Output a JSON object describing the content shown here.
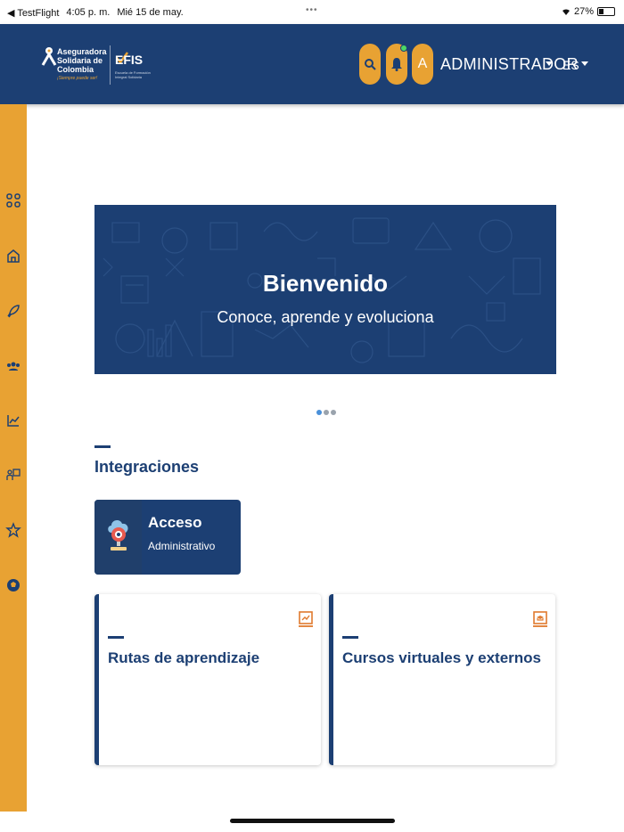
{
  "status_bar": {
    "back_app": "◀ TestFlight",
    "time": "4:05 p. m.",
    "date": "Mié 15 de may.",
    "dots": "•••",
    "battery": "27%"
  },
  "header": {
    "logo": {
      "name": "Aseguradora Solidaria de Colombia",
      "slogan": "¡Siempre puede ser!",
      "product": "EFIS",
      "product_sub": "Escuela de Formación Integral Solidaria"
    },
    "user_initial": "A",
    "user_name": "ADMINISTRADOR",
    "language": "ES"
  },
  "sidebar": {
    "items": [
      "apps-icon",
      "home-icon",
      "rocket-icon",
      "groups-icon",
      "chart-icon",
      "teacher-icon",
      "star-icon",
      "soccer-icon"
    ]
  },
  "banner": {
    "title": "Bienvenido",
    "subtitle": "Conoce, aprende y evoluciona"
  },
  "carousel": {
    "count": 3,
    "active": 0
  },
  "integrations": {
    "section_title": "Integraciones",
    "card": {
      "title": "Acceso",
      "subtitle": "Administrativo"
    }
  },
  "cards": [
    {
      "title": "Rutas de aprendizaje",
      "icon": "chart-board-icon"
    },
    {
      "title": "Cursos virtuales y externos",
      "icon": "online-course-icon"
    }
  ],
  "colors": {
    "primary": "#1c3f73",
    "accent": "#e8a233",
    "orange_icon": "#e07a2e"
  }
}
